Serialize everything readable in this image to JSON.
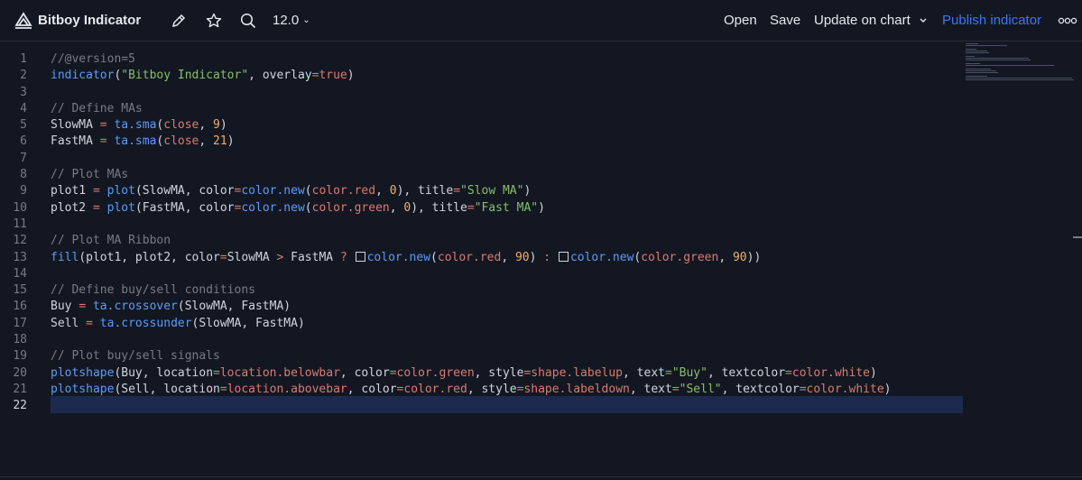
{
  "toolbar": {
    "title": "Bitboy Indicator",
    "version": "12.0",
    "open_label": "Open",
    "save_label": "Save",
    "update_label": "Update on chart",
    "publish_label": "Publish indicator"
  },
  "editor": {
    "line_numbers": [
      "1",
      "2",
      "3",
      "4",
      "5",
      "6",
      "7",
      "8",
      "9",
      "10",
      "11",
      "12",
      "13",
      "14",
      "15",
      "16",
      "17",
      "18",
      "19",
      "20",
      "21",
      "22"
    ],
    "lines": [
      "//@version=5",
      "indicator(\"Bitboy Indicator\", overlay=true)",
      "",
      "// Define MAs",
      "SlowMA = ta.sma(close, 9)",
      "FastMA = ta.sma(close, 21)",
      "",
      "// Plot MAs",
      "plot1 = plot(SlowMA, color=color.new(color.red, 0), title=\"Slow MA\")",
      "plot2 = plot(FastMA, color=color.new(color.green, 0), title=\"Fast MA\")",
      "",
      "// Plot MA Ribbon",
      "fill(plot1, plot2, color=SlowMA > FastMA ? color.new(color.red, 90) : color.new(color.green, 90))",
      "",
      "// Define buy/sell conditions",
      "Buy = ta.crossover(SlowMA, FastMA)",
      "Sell = ta.crossunder(SlowMA, FastMA)",
      "",
      "// Plot buy/sell signals",
      "plotshape(Buy, location=location.belowbar, color=color.green, style=shape.labelup, text=\"Buy\", textcolor=color.white)",
      "plotshape(Sell, location=location.abovebar, color=color.red, style=shape.labeldown, text=\"Sell\", textcolor=color.white)",
      ""
    ],
    "active_line": 22
  },
  "colors": {
    "background": "#131722",
    "accent": "#3b76f6",
    "swatch_red": "#f23645",
    "swatch_green": "#4caf50",
    "swatch_white": "#ffffff"
  },
  "icons": {
    "logo": "pine-logo-icon",
    "edit": "pencil-icon",
    "favorite": "star-icon",
    "search": "search-icon",
    "more": "more-icon"
  }
}
